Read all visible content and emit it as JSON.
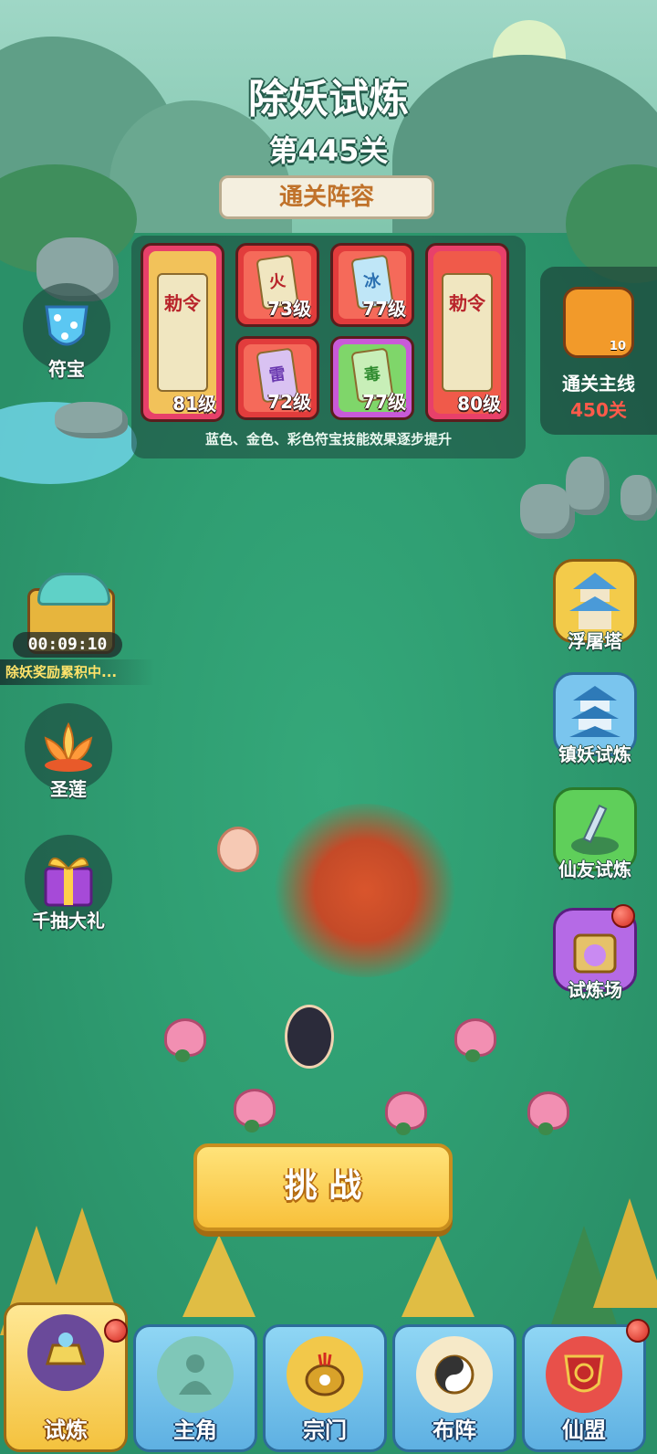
{
  "header": {
    "title": "除妖试炼",
    "stage": "第445关",
    "lineup_tab": "通关阵容"
  },
  "lineup": {
    "cards": [
      {
        "level": "81级",
        "glyph": "勅令",
        "color": "#e8a23c"
      },
      {
        "level": "73级",
        "glyph": "火",
        "color": "#e64a4a"
      },
      {
        "level": "77级",
        "glyph": "冰",
        "color": "#4aa8e8"
      },
      {
        "level": "80级",
        "glyph": "勅令",
        "color": "#e64a4a"
      },
      {
        "level": "72级",
        "glyph": "雷",
        "color": "#b56ae6"
      },
      {
        "level": "77级",
        "glyph": "毒",
        "color": "#5fcf5a"
      }
    ],
    "note": "蓝色、金色、彩色符宝技能效果逐步提升"
  },
  "mainline": {
    "label": "通关主线",
    "value": "450关",
    "count": "10"
  },
  "left_buttons": {
    "talisman": "符宝",
    "timer": "00:09:10",
    "accumulating": "除妖奖励累积中...",
    "lotus": "圣莲",
    "gift": "千抽大礼"
  },
  "right_buttons": {
    "tower": "浮屠塔",
    "suppress": "镇妖试炼",
    "friend": "仙友试炼",
    "arena": "试炼场"
  },
  "challenge_label": "挑 战",
  "nav": [
    {
      "label": "试炼",
      "icon": "altar-icon"
    },
    {
      "label": "主角",
      "icon": "hero-icon"
    },
    {
      "label": "宗门",
      "icon": "cauldron-icon"
    },
    {
      "label": "布阵",
      "icon": "formation-icon"
    },
    {
      "label": "仙盟",
      "icon": "alliance-icon"
    }
  ],
  "colors": {
    "ground": "#2f9e72",
    "button_gold": "#f8c03a",
    "nav_blue": "#5eb0e2",
    "highlight_red": "#ff5a4a"
  }
}
